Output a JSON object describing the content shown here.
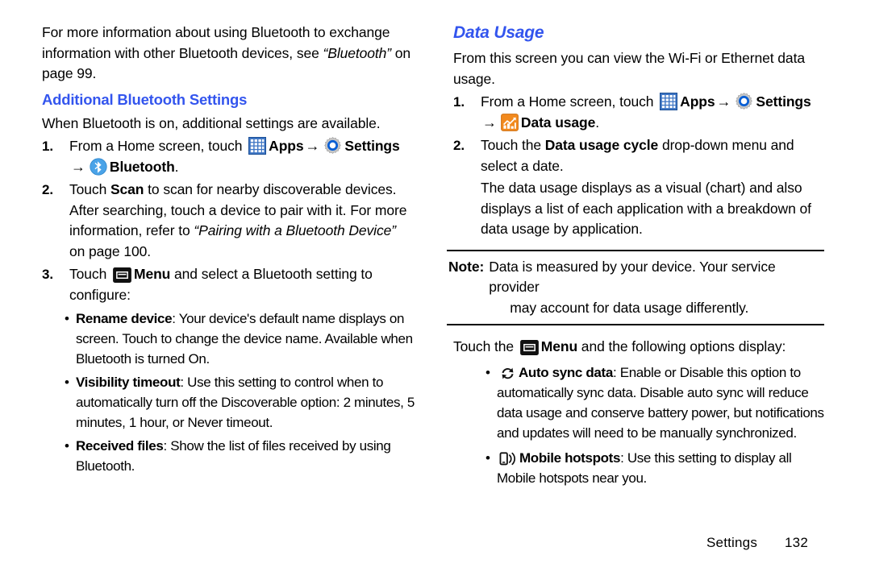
{
  "left_column": {
    "intro": {
      "part1": "For more information about using Bluetooth to exchange information with other Bluetooth devices, see ",
      "italic": "“Bluetooth”",
      "part2": " on page 99."
    },
    "heading": "Additional Bluetooth Settings",
    "subintro": "When Bluetooth is on, additional settings are available.",
    "steps": [
      {
        "num": "1.",
        "line1_pre": "From a Home screen, touch ",
        "apps_label": "Apps",
        "settings_label": "Settings",
        "bluetooth_label": "Bluetooth",
        "trailing_period": "."
      },
      {
        "num": "2.",
        "pre": "Touch ",
        "bold": "Scan",
        "mid": " to scan for nearby discoverable devices. After searching, touch a device to pair with it. For more information, refer to ",
        "italic": "“Pairing with a Bluetooth Device”",
        "post": " on page 100."
      },
      {
        "num": "3.",
        "pre": "Touch ",
        "menu_label": "Menu",
        "post": " and select a Bluetooth setting to configure:"
      }
    ],
    "bullets": [
      {
        "term": "Rename device",
        "desc": ": Your device's default name displays on screen. Touch to change the device name. Available when Bluetooth is turned On."
      },
      {
        "term": "Visibility timeout",
        "desc": ": Use this setting to control when to automatically turn off the Discoverable option: 2 minutes, 5 minutes, 1 hour, or Never timeout."
      },
      {
        "term": "Received files",
        "desc": ": Show the list of files received by using Bluetooth."
      }
    ]
  },
  "right_column": {
    "heading": "Data Usage",
    "intro": "From this screen you can view the Wi-Fi or Ethernet data usage.",
    "steps": [
      {
        "num": "1.",
        "line1_pre": "From a Home screen, touch ",
        "apps_label": "Apps",
        "settings_label": "Settings",
        "data_usage_label": "Data usage",
        "trailing_period": "."
      },
      {
        "num": "2.",
        "pre": "Touch the ",
        "bold": "Data usage cycle",
        "post": " drop-down menu and select a date.",
        "para2": "The data usage displays as a visual (chart) and also displays a list of each application with a breakdown of data usage by application."
      }
    ],
    "note": {
      "label": "Note:",
      "line1": "Data is measured by your device. Your service provider",
      "line2": "may account for data usage differently."
    },
    "touch_menu": {
      "pre": "Touch the ",
      "menu_label": "Menu",
      "post": " and the following options display:"
    },
    "options": [
      {
        "term": "Auto sync data",
        "desc": ": Enable or Disable this option to automatically sync data. Disable auto sync will reduce data usage and conserve battery power, but notifications and updates will need to be manually synchronized."
      },
      {
        "term": "Mobile hotspots",
        "desc": ": Use this setting to display all Mobile hotspots near you."
      }
    ]
  },
  "footer": {
    "section": "Settings",
    "page_number": "132"
  },
  "icons": {
    "apps": "apps-grid-icon",
    "settings": "settings-gear-icon",
    "bluetooth": "bluetooth-icon",
    "menu": "menu-icon",
    "data_usage": "data-usage-chart-icon",
    "auto_sync": "auto-sync-icon",
    "mobile_hotspot": "mobile-hotspot-icon",
    "arrow": "right-arrow-icon",
    "bullet": "bullet-dot-icon"
  },
  "colors": {
    "heading_blue": "#3355ee",
    "apps_blue": "#3f76c4",
    "bluetooth_blue": "#4aa3e8",
    "data_usage_orange": "#f28a1e",
    "text_black": "#000000"
  }
}
